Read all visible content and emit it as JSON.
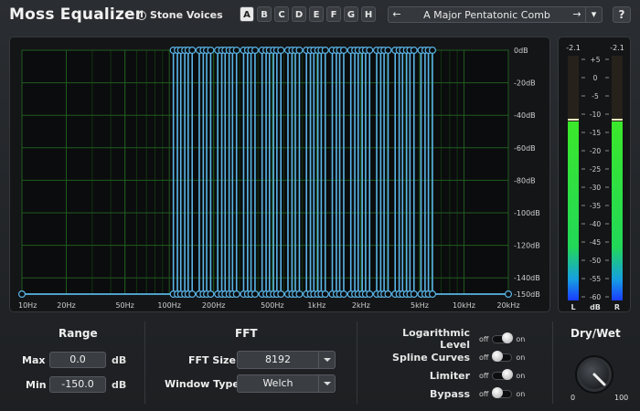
{
  "header": {
    "title": "Moss Equalizer",
    "vendor": "Stone Voices",
    "slots": [
      {
        "label": "A",
        "active": true
      },
      {
        "label": "B",
        "active": false
      },
      {
        "label": "C",
        "active": false
      },
      {
        "label": "D",
        "active": false
      },
      {
        "label": "E",
        "active": false
      },
      {
        "label": "F",
        "active": false
      },
      {
        "label": "G",
        "active": false
      },
      {
        "label": "H",
        "active": false
      }
    ],
    "preset_name": "A Major Pentatonic Comb",
    "prev_icon": "arrow-left-icon",
    "next_icon": "arrow-right-icon",
    "menu_icon": "chevron-down-icon",
    "help_label": "?"
  },
  "graph": {
    "db_ticks": [
      "0dB",
      "-20dB",
      "-40dB",
      "-60dB",
      "-80dB",
      "-100dB",
      "-120dB",
      "-140dB",
      "-150dB"
    ],
    "db_values": [
      0,
      -20,
      -40,
      -60,
      -80,
      -100,
      -120,
      -140,
      -150
    ],
    "freq_ticks": [
      "10Hz",
      "20Hz",
      "50Hz",
      "100Hz",
      "200Hz",
      "500Hz",
      "1kHz",
      "2kHz",
      "5kHz",
      "10kHz",
      "20kHz"
    ],
    "freq_values": [
      10,
      20,
      50,
      100,
      200,
      500,
      1000,
      2000,
      5000,
      10000,
      20000
    ],
    "min_freq": 10,
    "max_freq": 20000,
    "min_db": -150,
    "max_db": 0,
    "grid_color": "#1f5c1f",
    "curve_color": "#5ab4e6",
    "peaks": [
      110,
      123.47,
      138.59,
      164.81,
      185,
      220,
      246.94,
      277.18,
      329.63,
      369.99,
      440,
      493.88,
      554.37,
      659.25,
      739.99,
      880,
      987.77,
      1108.73,
      1318.51,
      1479.98,
      1760,
      1975.53,
      2217.46,
      2637.02,
      2959.96,
      3520,
      3951.07,
      4434.92,
      5274.04,
      5919.91
    ],
    "floor_points": [
      10,
      20000
    ]
  },
  "meter": {
    "peak_left": "-2.1",
    "peak_right": "-2.1",
    "scale_labels": [
      "+5",
      "0",
      "-5",
      "-10",
      "-15",
      "-20",
      "-25",
      "-30",
      "-35",
      "-40",
      "-45",
      "-50",
      "-55",
      "-60"
    ],
    "scale_values": [
      5,
      0,
      -5,
      -10,
      -15,
      -20,
      -25,
      -30,
      -35,
      -40,
      -45,
      -50,
      -55,
      -60
    ],
    "label_left": "L",
    "label_db": "dB",
    "label_right": "R",
    "level_left_db": -12,
    "level_right_db": -12,
    "scale_max": 6,
    "scale_min": -61
  },
  "range": {
    "title": "Range",
    "max_label": "Max",
    "max_value": "0.0",
    "min_label": "Min",
    "min_value": "-150.0",
    "unit": "dB"
  },
  "fft": {
    "title": "FFT",
    "size_label": "FFT Size",
    "size_value": "8192",
    "window_label": "Window Type",
    "window_value": "Welch"
  },
  "toggles": [
    {
      "label": "Logarithmic Level",
      "off": "off",
      "on": "on",
      "state": true
    },
    {
      "label": "Spline Curves",
      "off": "off",
      "on": "on",
      "state": false
    },
    {
      "label": "Limiter",
      "off": "off",
      "on": "on",
      "state": true
    },
    {
      "label": "Bypass",
      "off": "off",
      "on": "on",
      "state": false
    }
  ],
  "drywet": {
    "title": "Dry/Wet",
    "min_label": "0",
    "max_label": "100",
    "value": 100
  }
}
